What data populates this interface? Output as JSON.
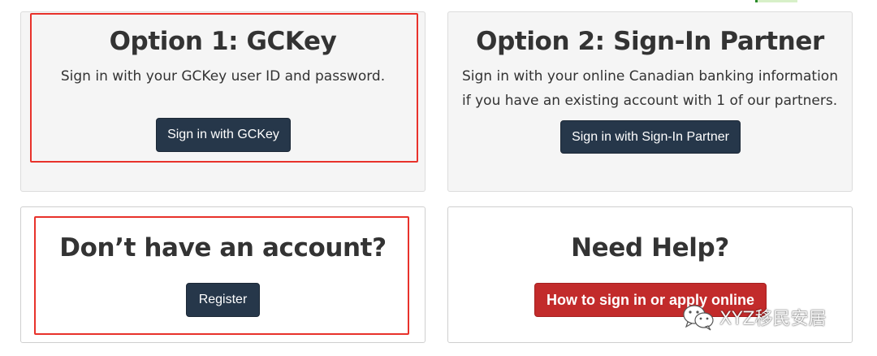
{
  "option1": {
    "title": "Option 1: GCKey",
    "description": "Sign in with your GCKey user ID and password.",
    "button": "Sign in with GCKey"
  },
  "option2": {
    "title": "Option 2: Sign-In Partner",
    "description_line1": "Sign in with your online Canadian banking information",
    "description_line2": "if you have an existing account with 1 of our partners.",
    "button": "Sign in with Sign-In Partner"
  },
  "register": {
    "title": "Don’t have an account?",
    "button": "Register"
  },
  "help": {
    "title": "Need Help?",
    "button": "How to sign in or apply online"
  },
  "watermark": {
    "icon": "wechat-icon",
    "text": "XYZ移民安居"
  },
  "colors": {
    "button_dark": "#26374a",
    "button_red": "#c22b2b",
    "highlight": "#e8322b",
    "panel_grey": "#f5f5f5"
  }
}
